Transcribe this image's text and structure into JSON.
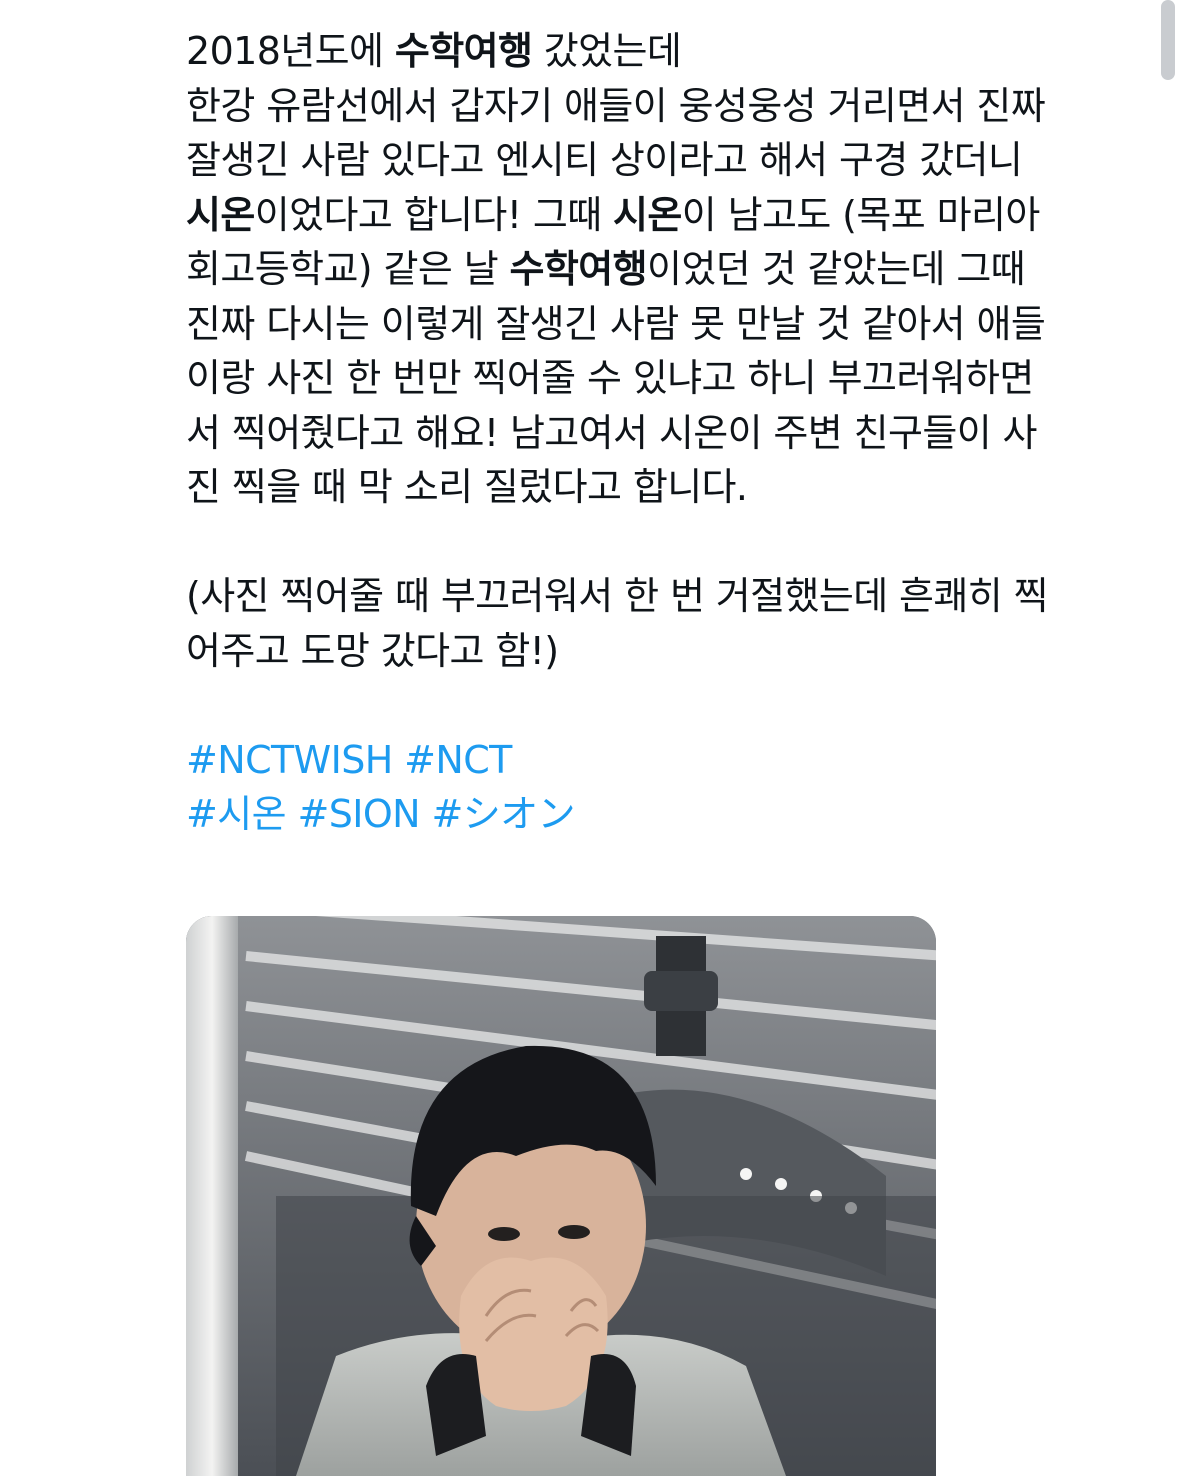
{
  "tweet": {
    "lines": [
      [
        {
          "t": "2018년도에 "
        },
        {
          "t": "수학여행",
          "b": true
        },
        {
          "t": " 갔었는데"
        }
      ],
      [
        {
          "t": "한강 유람선에서 갑자기 애들이 웅성웅성 거리면서 진짜"
        }
      ],
      [
        {
          "t": "잘생긴 사람 있다고 엔시티 상이라고 해서 구경 갔더니"
        }
      ],
      [
        {
          "t": "시온",
          "b": true
        },
        {
          "t": "이었다고 합니다! 그때 "
        },
        {
          "t": "시온",
          "b": true
        },
        {
          "t": "이 남고도 (목포 마리아"
        }
      ],
      [
        {
          "t": "회고등학교) 같은 날 "
        },
        {
          "t": "수학여행",
          "b": true
        },
        {
          "t": "이었던 것 같았는데 그때"
        }
      ],
      [
        {
          "t": "진짜 다시는 이렇게 잘생긴 사람 못 만날 것 같아서 애들"
        }
      ],
      [
        {
          "t": "이랑 사진 한 번만 찍어줄 수 있냐고 하니 부끄러워하면"
        }
      ],
      [
        {
          "t": "서 찍어줬다고 해요! 남고여서 시온이 주변 친구들이 사"
        }
      ],
      [
        {
          "t": "진 찍을 때 막 소리 질렀다고 합니다."
        }
      ],
      [],
      [
        {
          "t": "(사진 찍어줄 때 부끄러워서 한 번 거절했는데 흔쾌히 찍"
        }
      ],
      [
        {
          "t": "어주고 도망 갔다고 함!)"
        }
      ],
      [],
      [
        {
          "t": "#NCTWISH",
          "h": true
        },
        {
          "t": " "
        },
        {
          "t": "#NCT",
          "h": true
        }
      ],
      [
        {
          "t": "#시온",
          "h": true
        },
        {
          "t": " "
        },
        {
          "t": "#SION",
          "h": true
        },
        {
          "t": " "
        },
        {
          "t": "#シオン",
          "h": true
        }
      ]
    ]
  },
  "media": {
    "alt_icon": "photo-of-person-covering-face"
  },
  "colors": {
    "text": "#0f1419",
    "hashtag": "#1d9bf0",
    "background": "#ffffff"
  }
}
